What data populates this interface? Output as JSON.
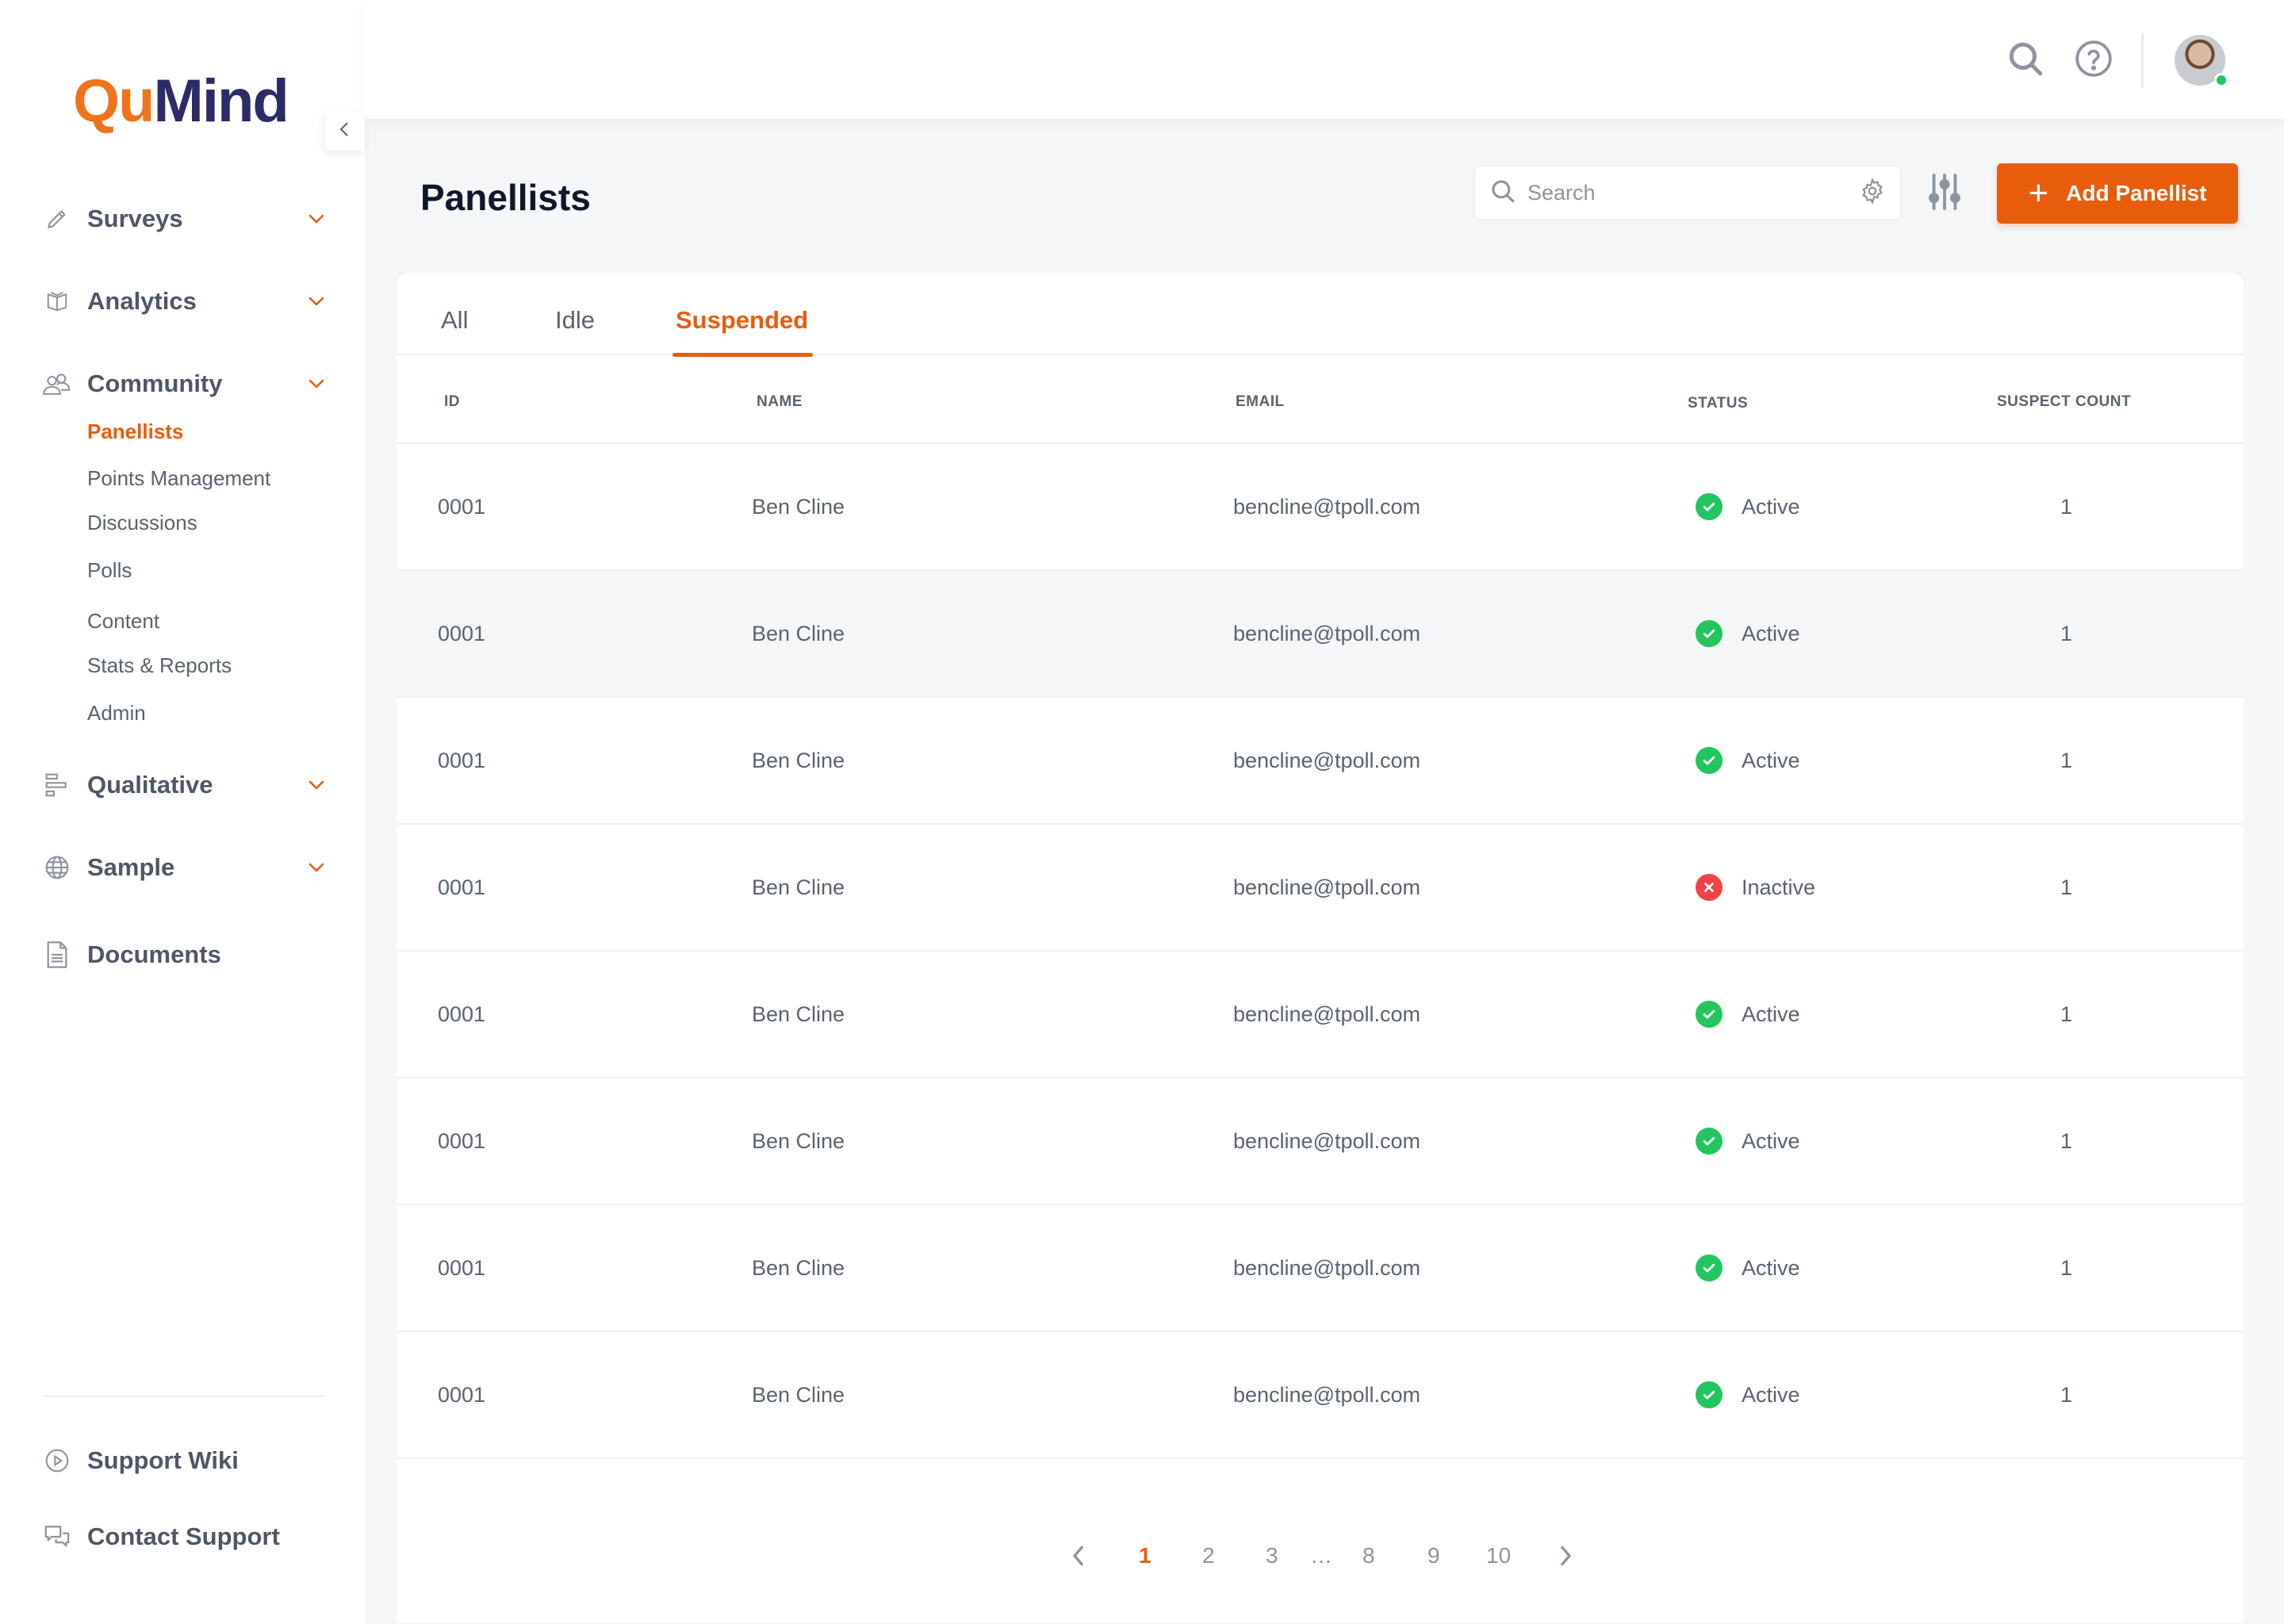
{
  "brand": {
    "part1": "Qu",
    "part2": "Mind",
    "accent": "#e85d0c",
    "navy": "#2d2a68"
  },
  "sidebar": {
    "collapse_icon": "chevron-left-icon",
    "groups": [
      {
        "label": "Surveys",
        "icon": "pencil-icon",
        "expandable": true
      },
      {
        "label": "Analytics",
        "icon": "book-icon",
        "expandable": true
      },
      {
        "label": "Community",
        "icon": "users-icon",
        "expandable": true
      },
      {
        "label": "Qualitative",
        "icon": "bars-icon",
        "expandable": true
      },
      {
        "label": "Sample",
        "icon": "globe-icon",
        "expandable": true
      },
      {
        "label": "Documents",
        "icon": "document-icon",
        "expandable": false
      }
    ],
    "community_items": [
      {
        "label": "Panellists",
        "active": true
      },
      {
        "label": "Points Management",
        "active": false
      },
      {
        "label": "Discussions",
        "active": false
      },
      {
        "label": "Polls",
        "active": false
      },
      {
        "label": "Content",
        "active": false
      },
      {
        "label": "Stats & Reports",
        "active": false
      },
      {
        "label": "Admin",
        "active": false
      }
    ],
    "footer": [
      {
        "label": "Support Wiki",
        "icon": "play-circle-icon"
      },
      {
        "label": "Contact Support",
        "icon": "chat-icon"
      }
    ]
  },
  "header": {
    "icons": [
      "search-icon",
      "help-icon"
    ],
    "user": {
      "online": true
    }
  },
  "page": {
    "title": "Panellists",
    "search": {
      "placeholder": "Search",
      "value": ""
    },
    "add_button": "Add Panellist"
  },
  "tabs": [
    {
      "label": "All",
      "active": false
    },
    {
      "label": "Idle",
      "active": false
    },
    {
      "label": "Suspended",
      "active": true
    }
  ],
  "table": {
    "columns": [
      "ID",
      "NAME",
      "EMAIL",
      "STATUS",
      "SUSPECT COUNT"
    ],
    "rows": [
      {
        "id": "0001",
        "name": "Ben Cline",
        "email": "bencline@tpoll.com",
        "status": "Active",
        "suspect_count": "1"
      },
      {
        "id": "0001",
        "name": "Ben Cline",
        "email": "bencline@tpoll.com",
        "status": "Active",
        "suspect_count": "1"
      },
      {
        "id": "0001",
        "name": "Ben Cline",
        "email": "bencline@tpoll.com",
        "status": "Active",
        "suspect_count": "1"
      },
      {
        "id": "0001",
        "name": "Ben Cline",
        "email": "bencline@tpoll.com",
        "status": "Inactive",
        "suspect_count": "1"
      },
      {
        "id": "0001",
        "name": "Ben Cline",
        "email": "bencline@tpoll.com",
        "status": "Active",
        "suspect_count": "1"
      },
      {
        "id": "0001",
        "name": "Ben Cline",
        "email": "bencline@tpoll.com",
        "status": "Active",
        "suspect_count": "1"
      },
      {
        "id": "0001",
        "name": "Ben Cline",
        "email": "bencline@tpoll.com",
        "status": "Active",
        "suspect_count": "1"
      },
      {
        "id": "0001",
        "name": "Ben Cline",
        "email": "bencline@tpoll.com",
        "status": "Active",
        "suspect_count": "1"
      }
    ],
    "highlighted_row": 1,
    "status_colors": {
      "Active": "#22c55e",
      "Inactive": "#ef4444"
    }
  },
  "pagination": {
    "current": "1",
    "pages": [
      "1",
      "2",
      "3",
      "…",
      "8",
      "9",
      "10"
    ]
  }
}
